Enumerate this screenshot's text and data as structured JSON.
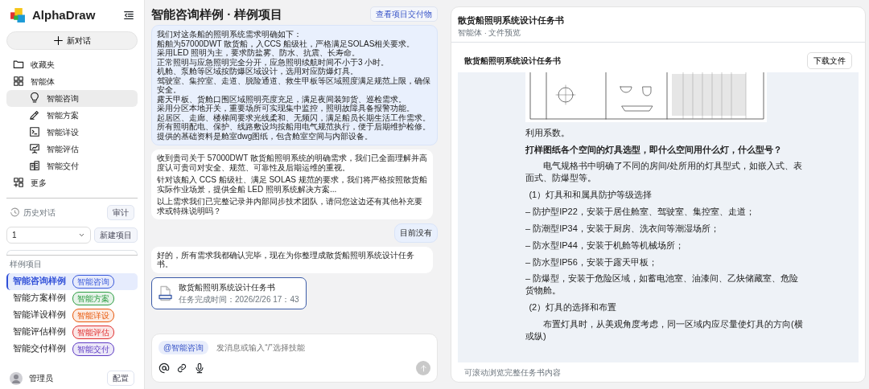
{
  "sidebar": {
    "brand": "AlphaDraw",
    "new_chat": "新对话",
    "nav": [
      {
        "label": "收藏夹"
      },
      {
        "label": "智能体",
        "children": [
          {
            "label": "智能咨询",
            "selected": true
          },
          {
            "label": "智能方案",
            "selected": false
          },
          {
            "label": "智能详设",
            "selected": false
          },
          {
            "label": "智能评估",
            "selected": false
          },
          {
            "label": "智能交付",
            "selected": false
          }
        ]
      },
      {
        "label": "更多"
      }
    ],
    "history": {
      "label": "历史对话",
      "audit": "审计"
    },
    "project": {
      "value": "1",
      "new_project": "新建项目"
    },
    "examples": {
      "heading": "样例项目",
      "items": [
        {
          "name": "智能咨询样例",
          "tag": "智能咨询",
          "color": "#3b5bdb",
          "selected": true
        },
        {
          "name": "智能方案样例",
          "tag": "智能方案",
          "color": "#2f9e44",
          "selected": false
        },
        {
          "name": "智能详设样例",
          "tag": "智能详设",
          "color": "#e8590c",
          "selected": false
        },
        {
          "name": "智能评估样例",
          "tag": "智能评估",
          "color": "#e03131",
          "selected": false
        },
        {
          "name": "智能交付样例",
          "tag": "智能交付",
          "color": "#5f3dc4",
          "selected": false
        }
      ]
    },
    "user": {
      "name": "管理员",
      "config": "配置"
    }
  },
  "chat": {
    "title": "智能咨询样例 · 样例项目",
    "deliverables": "查看项目交付物",
    "messages": [
      {
        "kind": "user",
        "lines": [
          "我们对这条船的照明系统需求明确如下：",
          "船舶为57000DWT 散货船，入CCS 船级社，严格满足SOLAS相关要求。",
          "采用LED 照明为主，要求防盐雾、防水、抗震、长寿命。",
          "正常照明与应急照明完全分开，应急照明续航时间不小于3 小时。",
          "机舱、泵舱等区域按防爆区域设计，选用对应防爆灯具。",
          "驾驶室、集控室、走道、脱险通道、救生甲板等区域照度满足规范上限，确保安全。",
          "露天甲板、货舱口围区域照明亮度充足，满足夜间装卸货、巡检需求。",
          "采用分区本地开关，重要场所可实现集中监控，照明故障具备报警功能。",
          "起居区、走廊、楼梯间要求光线柔和、无频闪，满足船员长期生活工作需求。",
          "所有照明配电、保护、线路敷设均按船用电气规范执行，便于后期维护检修。",
          "提供的基础资料是舱室dwg图纸，包含舱室空间与内部设备。"
        ]
      },
      {
        "kind": "assistant",
        "lines": [
          "收到贵司关于 57000DWT 散货船照明系统的明确需求，我们已全面理解并高度认可贵司对安全、规范、可靠性及后期运维的重视。",
          "针对该船入 CCS 船级社、满足 SOLAS 规范的要求，我们将严格按照散货船实际作业场景，提供全船 LED 照明系统解决方案...",
          "以上需求我们已完整记录并内部同步技术团队，请问您这边还有其他补充要求或特殊说明吗？"
        ]
      },
      {
        "kind": "user",
        "lines": [
          "目前没有"
        ]
      },
      {
        "kind": "assistant",
        "lines": [
          "好的，所有需求我都确认完毕，现在为你整理成散货船照明系统设计任务书。"
        ]
      },
      {
        "kind": "file",
        "title": "散货船照明系统设计任务书",
        "time": "任务完成时间：2026/2/26 17：43"
      }
    ],
    "input": {
      "skill": "@智能咨询",
      "placeholder": "发消息或输入“/”选择技能"
    }
  },
  "document": {
    "title": "散货船照明系统设计任务书",
    "breadcrumb": "智能体 · 文件预览",
    "file_title": "散货船照明系统设计任务书",
    "download": "下载文件",
    "blocks": [
      {
        "kind": "picture"
      },
      {
        "kind": "text",
        "text": "利用系数。"
      },
      {
        "kind": "bold",
        "text": "打样图纸各个空间的灯具选型，即什么空间用什么灯，什么型号？"
      },
      {
        "kind": "indent",
        "text": "电气规格书中明确了不同的房间/处所用的灯具型式，如嵌入式、表面式、防爆型等。"
      },
      {
        "kind": "numbered",
        "text": "(1）灯具和和属具防护等级选择"
      },
      {
        "kind": "text",
        "text": "– 防护型IP22，安装于居住舱室、驾驶室、集控室、走道；"
      },
      {
        "kind": "text",
        "text": "– 防潮型IP34，安装于厨房、洗衣间等潮湿场所；"
      },
      {
        "kind": "text",
        "text": "– 防水型IP44，安装于机舱等机械场所；"
      },
      {
        "kind": "text",
        "text": "– 防水型IP56，安装于露天甲板；"
      },
      {
        "kind": "text",
        "text": "– 防爆型，安装于危险区域，如蓄电池室、油漆间、乙炔储藏室、危险货物舱。"
      },
      {
        "kind": "numbered",
        "text": "(2）灯具的选择和布置"
      },
      {
        "kind": "indent",
        "text": "布置灯具时，从美观角度考虑，同一区域内应尽量使灯具的方向(横或纵)"
      }
    ],
    "footer": "可滚动浏览完整任务书内容"
  }
}
